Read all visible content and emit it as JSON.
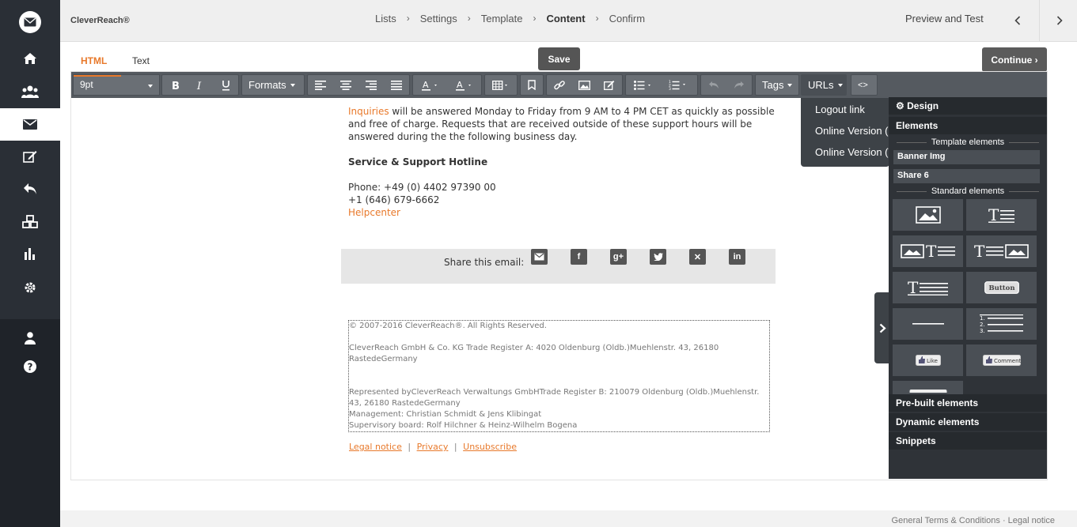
{
  "header": {
    "brand": "CleverReach®",
    "steps": [
      {
        "label": "Lists"
      },
      {
        "label": "Settings"
      },
      {
        "label": "Template"
      },
      {
        "label": "Content"
      },
      {
        "label": "Confirm"
      }
    ],
    "preview_label": "Preview and Test"
  },
  "tabs": {
    "html": "HTML",
    "text": "Text"
  },
  "buttons": {
    "save": "Save",
    "continue": "Continue ›"
  },
  "toolbar": {
    "font_size": "9pt",
    "formats": "Formats",
    "tags": "Tags",
    "urls": "URLs",
    "source": "<>"
  },
  "urls_menu": [
    "Logout link",
    "Online Version (H",
    "Online Version (T"
  ],
  "content": {
    "inquiries_link": "Inquiries",
    "inquiries_text": " will be answered Monday to Friday from 9 AM to 4 PM CET as quickly as possible and free of charge. Requests that are received outside of these support hours will be answered during the the following business day.",
    "hotline_heading": "Service & Support Hotline",
    "phone1": "Phone: +49 (0) 4402 97390 00",
    "phone2": "+1 (646) 679-6662",
    "helpcenter": "Helpcenter",
    "share_label": "Share this email:",
    "footer_lines": [
      "© 2007-2016 CleverReach®. All Rights Reserved.",
      "",
      "CleverReach GmbH & Co. KG Trade Register A: 4020 Oldenburg (Oldb.)Muehlenstr. 43, 26180",
      "RastedeGermany",
      "",
      "",
      "Represented byCleverReach Verwaltungs GmbHTrade Register B: 210079 Oldenburg (Oldb.)Muehlenstr.",
      "43, 26180 RastedeGermany",
      "Management: Christian Schmidt & Jens Klibingat",
      "Supervisory board: Rolf Hilchner & Heinz-Wilhelm Bogena"
    ],
    "legal_notice": "Legal notice",
    "privacy": "Privacy",
    "unsubscribe": "Unsubscribe",
    "link_sep": "|"
  },
  "panel": {
    "design": "Design",
    "elements": "Elements",
    "template_elements": "Template elements",
    "template_items": [
      "Banner Img",
      "Share 6"
    ],
    "standard_elements": "Standard elements",
    "tile_button": "Button",
    "tile_like": "Like",
    "tile_comment": "Comment",
    "prebuilt": "Pre-built elements",
    "dynamic": "Dynamic elements",
    "snippets": "Snippets"
  },
  "footer": {
    "links": "General Terms & Conditions · Legal notice"
  },
  "colors": {
    "accent": "#e8792b",
    "rail": "#2a2f36",
    "toolbar": "#555a60",
    "panel": "#2f3338"
  }
}
